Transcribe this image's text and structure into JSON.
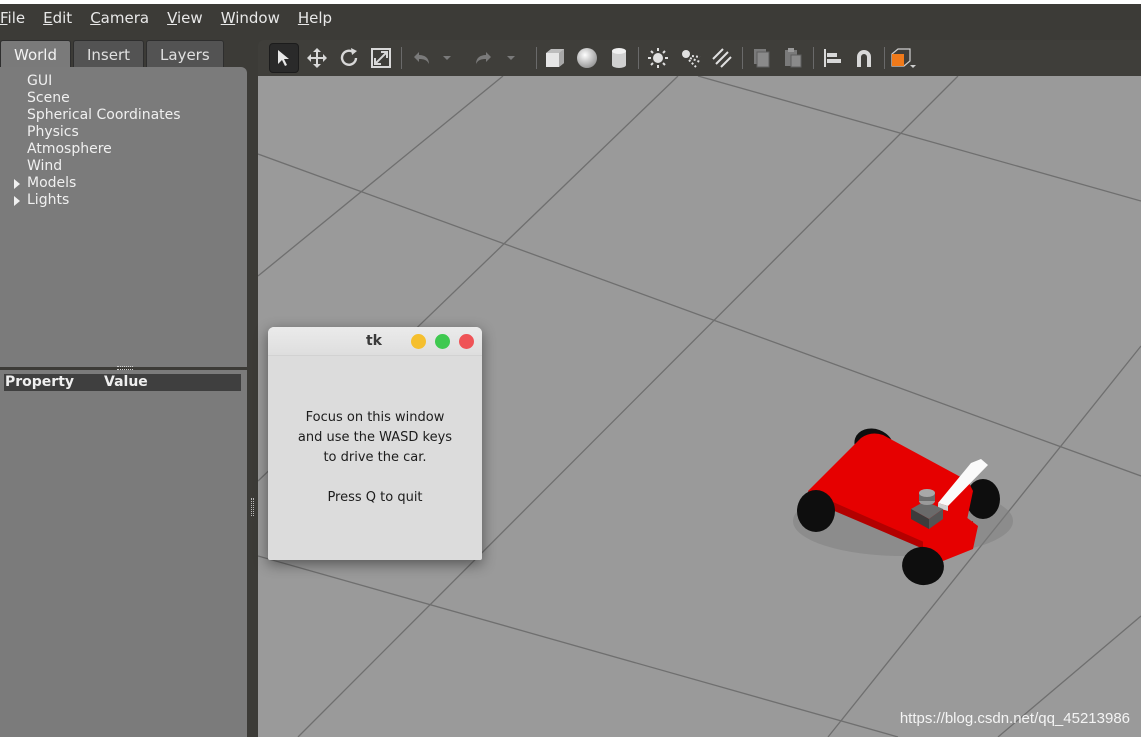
{
  "menubar": {
    "items": [
      {
        "underline": "F",
        "rest": "ile"
      },
      {
        "underline": "E",
        "rest": "dit"
      },
      {
        "underline": "C",
        "rest": "amera"
      },
      {
        "underline": "V",
        "rest": "iew"
      },
      {
        "underline": "W",
        "rest": "indow"
      },
      {
        "underline": "H",
        "rest": "elp"
      }
    ]
  },
  "left_panel": {
    "tabs": [
      "World",
      "Insert",
      "Layers"
    ],
    "active_tab": "World",
    "tree": [
      "GUI",
      "Scene",
      "Spherical Coordinates",
      "Physics",
      "Atmosphere",
      "Wind",
      "Models",
      "Lights"
    ],
    "property_header": {
      "property": "Property",
      "value": "Value"
    }
  },
  "toolbar": {
    "icons": [
      "select-arrow-icon",
      "translate-icon",
      "rotate-icon",
      "scale-icon",
      "undo-icon",
      "undo-dropdown-icon",
      "redo-icon",
      "redo-dropdown-icon",
      "box-shape-icon",
      "sphere-shape-icon",
      "cylinder-shape-icon",
      "point-light-icon",
      "spot-light-icon",
      "directional-light-icon",
      "copy-icon",
      "paste-icon",
      "align-icon",
      "snap-magnet-icon",
      "view-angle-icon"
    ]
  },
  "tk_window": {
    "title": "tk",
    "line1": "Focus on this window",
    "line2": "and use the WASD keys",
    "line3": "to drive the car.",
    "line4": "Press Q to quit",
    "colors": {
      "minimize": "#f5bf2e",
      "maximize": "#3fc950",
      "close": "#ef5356"
    }
  },
  "watermark": "https://blog.csdn.net/qq_45213986",
  "colors": {
    "viewport": "#9a9a9a",
    "car_body": "#e60000",
    "panel": "#7b7b7b"
  }
}
